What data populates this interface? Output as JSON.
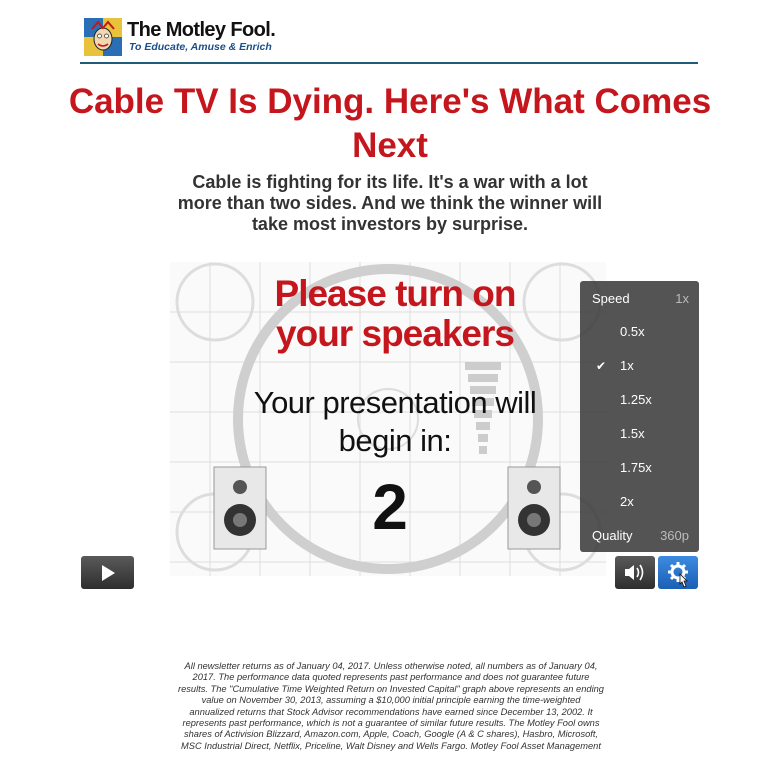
{
  "brand": {
    "name": "The Motley Fool.",
    "tagline": "To Educate, Amuse & Enrich"
  },
  "headline": "Cable TV Is Dying. Here's What Comes Next",
  "subhead": "Cable is fighting for its life. It's a war with a lot more than two sides. And we think the winner will take most investors by surprise.",
  "video": {
    "line1": "Please turn on your speakers",
    "line2": "Your presentation will begin in:",
    "countdown": "2"
  },
  "settings_menu": {
    "speed_label": "Speed",
    "speed_value": "1x",
    "options": [
      "0.5x",
      "1x",
      "1.25x",
      "1.5x",
      "1.75x",
      "2x"
    ],
    "selected": "1x",
    "quality_label": "Quality",
    "quality_value": "360p"
  },
  "colors": {
    "headline": "#c4161c",
    "accent_rule": "#1f5c7a",
    "gear_active": "#2f7fd6"
  },
  "disclaimer": "All newsletter returns as of January 04, 2017. Unless otherwise noted, all numbers as of January 04, 2017. The performance data quoted represents past performance and does not guarantee future results. The \"Cumulative Time Weighted Return on Invested Capital\" graph above represents an ending value on November 30, 2013, assuming a $10,000 initial principle earning the time-weighted annualized returns that Stock Advisor recommendations have earned since December 13, 2002. It represents past performance, which is not a guarantee of similar future results. The Motley Fool owns shares of Activision Blizzard, Amazon.com, Apple, Coach, Google (A & C shares), Hasbro, Microsoft, MSC Industrial Direct, Netflix, Priceline, Walt Disney and Wells Fargo. Motley Fool Asset Management"
}
